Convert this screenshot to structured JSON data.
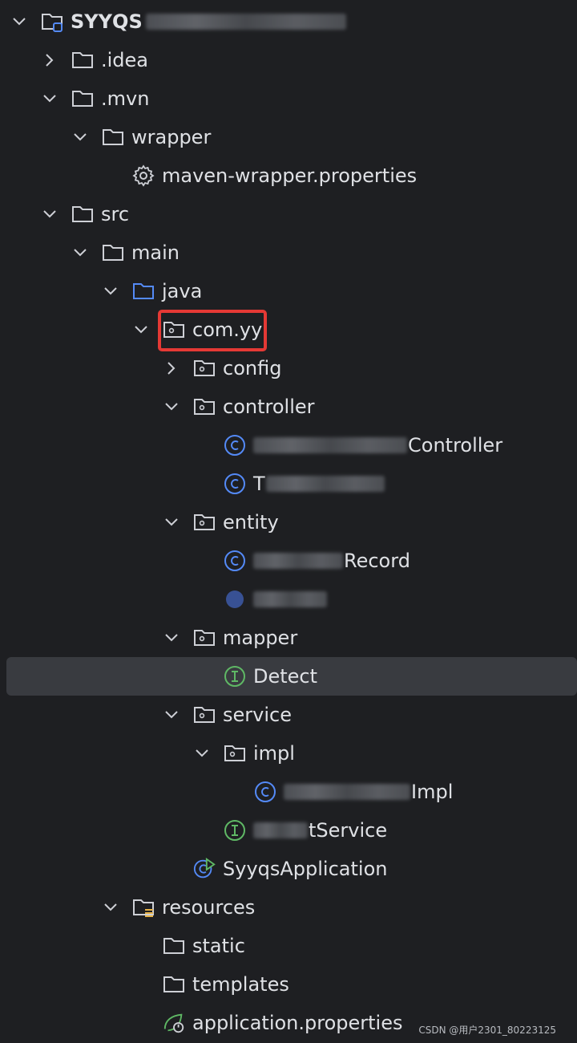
{
  "project": {
    "name": "SYYQS"
  },
  "tree": {
    "idea": ".idea",
    "mvn": ".mvn",
    "wrapper": "wrapper",
    "maven_wrapper_props": "maven-wrapper.properties",
    "src": "src",
    "main": "main",
    "java": "java",
    "package": "com.yy",
    "config": "config",
    "controller": "controller",
    "controller_class_suffix": "Controller",
    "test_controller_prefix": "T",
    "entity": "entity",
    "entity_class_suffix": "Record",
    "mapper": "mapper",
    "mapper_interface": "Detect",
    "service": "service",
    "impl": "impl",
    "impl_class_suffix": "Impl",
    "service_interface_suffix": "tService",
    "app_class": "SyyqsApplication",
    "resources": "resources",
    "static": "static",
    "templates": "templates",
    "app_properties": "application.properties"
  },
  "watermark": "CSDN @用户2301_80223125",
  "colors": {
    "background": "#1e1f22",
    "selected_row": "#393b40",
    "highlight_box": "#e53935",
    "class_icon": "#548af7",
    "interface_icon": "#5fb865",
    "java_folder": "#548af7"
  }
}
